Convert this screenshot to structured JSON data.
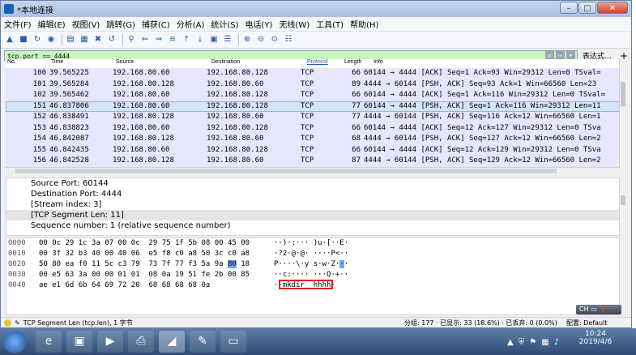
{
  "window": {
    "title": "*本地连接",
    "buttons": {
      "minimize": "–",
      "maximize": "□",
      "close": "✕"
    }
  },
  "menu": [
    "文件(F)",
    "编辑(E)",
    "视图(V)",
    "跳转(G)",
    "捕获(C)",
    "分析(A)",
    "统计(S)",
    "电话(Y)",
    "无线(W)",
    "工具(T)",
    "帮助(H)"
  ],
  "toolbar_icons": [
    "shark-fin-start-icon",
    "stop-icon",
    "restart-icon",
    "options-gear-icon",
    "open-folder-icon",
    "save-icon",
    "close-file-icon",
    "reload-icon",
    "find-icon",
    "go-back-icon",
    "go-forward-icon",
    "go-to-packet-icon",
    "first-packet-icon",
    "last-packet-icon",
    "autoscroll-icon",
    "colorize-icon",
    "zoom-in-icon",
    "zoom-out-icon",
    "zoom-reset-icon",
    "resize-columns-icon"
  ],
  "filter": {
    "value": "tcp.port == 4444",
    "expression_label": "表达式…",
    "add_label": "+"
  },
  "columns": {
    "no": "No.",
    "time": "Time",
    "source": "Source",
    "destination": "Destination",
    "protocol": "Protocol",
    "length": "Length",
    "info": "Info"
  },
  "packets": [
    {
      "no": "100",
      "time": "39.565225",
      "src": "192.168.80.60",
      "dst": "192.168.80.128",
      "proto": "TCP",
      "len": "66",
      "info": "60144 → 4444 [ACK] Seq=1 Ack=93 Win=29312 Len=0 TSval="
    },
    {
      "no": "101",
      "time": "39.565284",
      "src": "192.168.80.128",
      "dst": "192.168.80.60",
      "proto": "TCP",
      "len": "89",
      "info": "4444 → 60144 [PSH, ACK] Seq=93 Ack=1 Win=66560 Len=23"
    },
    {
      "no": "102",
      "time": "39.565462",
      "src": "192.168.80.60",
      "dst": "192.168.80.128",
      "proto": "TCP",
      "len": "66",
      "info": "60144 → 4444 [ACK] Seq=1 Ack=116 Win=29312 Len=0 TSval="
    },
    {
      "no": "151",
      "time": "46.837806",
      "src": "192.168.80.60",
      "dst": "192.168.80.128",
      "proto": "TCP",
      "len": "77",
      "info": "60144 → 4444 [PSH, ACK] Seq=1 Ack=116 Win=29312 Len=11"
    },
    {
      "no": "152",
      "time": "46.838491",
      "src": "192.168.80.128",
      "dst": "192.168.80.60",
      "proto": "TCP",
      "len": "77",
      "info": "4444 → 60144 [PSH, ACK] Seq=116 Ack=12 Win=66560 Len=1"
    },
    {
      "no": "153",
      "time": "46.838823",
      "src": "192.168.80.60",
      "dst": "192.168.80.128",
      "proto": "TCP",
      "len": "66",
      "info": "60144 → 4444 [ACK] Seq=12 Ack=127 Win=29312 Len=0 TSva"
    },
    {
      "no": "154",
      "time": "46.842087",
      "src": "192.168.80.128",
      "dst": "192.168.80.60",
      "proto": "TCP",
      "len": "68",
      "info": "4444 → 60144 [PSH, ACK] Seq=127 Ack=12 Win=66560 Len=2"
    },
    {
      "no": "155",
      "time": "46.842435",
      "src": "192.168.80.60",
      "dst": "192.168.80.128",
      "proto": "TCP",
      "len": "66",
      "info": "60144 → 4444 [ACK] Seq=12 Ack=129 Win=29312 Len=0 TSva"
    },
    {
      "no": "156",
      "time": "46.842528",
      "src": "192.168.80.128",
      "dst": "192.168.80.60",
      "proto": "TCP",
      "len": "87",
      "info": "4444 → 60144 [PSH, ACK] Seq=129 Ack=12 Win=66560 Len=2"
    }
  ],
  "selected_packet_index": 3,
  "details": [
    "Source Port: 60144",
    "Destination Port: 4444",
    "[Stream index: 3]",
    "[TCP Segment Len: 11]",
    "Sequence number: 1    (relative sequence number)"
  ],
  "selected_detail_index": 3,
  "bytes": [
    {
      "offset": "0000",
      "hex": "00 0c 29 1c 3a 07 00 0c  29 75 1f 5b 08 00 45 00",
      "ascii": "··)·:··· )u·[··E·"
    },
    {
      "offset": "0010",
      "hex": "00 3f 32 b3 40 00 40 06  e5 f8 c0 a8 50 3c c0 a8",
      "ascii": "·?2·@·@· ····P<··"
    },
    {
      "offset": "0020",
      "hex": "50 80 ea f0 11 5c c3 79  73 7f 77 f3 5a 9a ",
      "hex_hl": "80",
      "hex_tail": " 18",
      "ascii": "P····\\·y s·w·Z·",
      "ascii_hl": "·",
      "ascii_tail": "·"
    },
    {
      "offset": "0030",
      "hex": "00 e5 63 3a 00 00 01 01  08 0a 19 51 fe 2b 00 85",
      "ascii": "··c:···· ···Q·+··"
    },
    {
      "offset": "0040",
      "hex": "ae e1 6d 6b 64 69 72 20  68 68 68 68 0a",
      "ascii": "··mkdir  hhhh·"
    }
  ],
  "status": {
    "left": "TCP Segment Len (tcp.len), 1 字节",
    "middle": "分组: 177 · 已显示: 33 (18.6%) · 已丢弃: 0 (0.0%)",
    "right": "配置: Default"
  },
  "ime": "CH",
  "taskbar": {
    "apps": [
      "windows-explorer-icon",
      "ie-icon",
      "explorer-folder-icon",
      "media-player-icon",
      "printer-icon",
      "wireshark-icon",
      "paint-icon",
      "cmd-icon"
    ],
    "time": "10:24",
    "date": "2019/4/6"
  }
}
